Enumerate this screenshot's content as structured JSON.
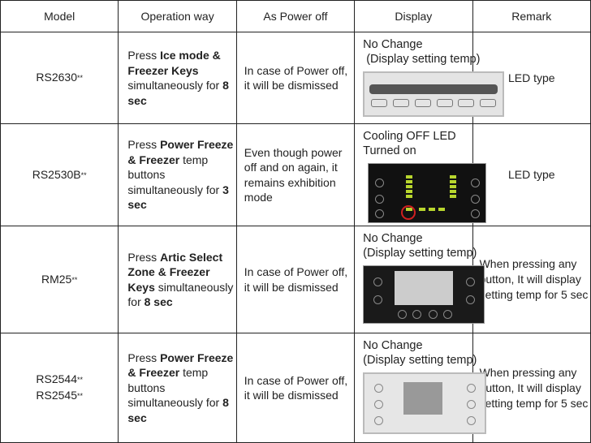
{
  "headers": [
    "Model",
    "Operation way",
    "As Power off",
    "Display",
    "Remark"
  ],
  "rows": [
    {
      "models": [
        "RS2630"
      ],
      "stars": "**",
      "operation": [
        {
          "text": "Press ",
          "bold": false
        },
        {
          "text": "Ice mode & Freezer Keys",
          "bold": true
        },
        {
          "text": " simultaneously for ",
          "bold": false
        },
        {
          "text": "8 sec",
          "bold": true
        }
      ],
      "power_off": "In case of Power off, it will be dismissed",
      "display_line1": "No Change",
      "display_line2": " (Display setting temp)",
      "display_panel": "light-led-panel",
      "remark": "LED type"
    },
    {
      "models": [
        "RS2530B"
      ],
      "stars": "**",
      "operation": [
        {
          "text": "Press ",
          "bold": false
        },
        {
          "text": "Power Freeze & Freezer",
          "bold": true
        },
        {
          "text": " temp buttons simultaneously for ",
          "bold": false
        },
        {
          "text": "3 sec",
          "bold": true
        }
      ],
      "power_off": "Even though power off and on again, it remains exhibition mode",
      "display_line1": "Cooling OFF LED",
      "display_line2": "Turned on",
      "display_panel": "dark-led-panel",
      "remark": "LED type"
    },
    {
      "models": [
        "RM25"
      ],
      "stars": "**",
      "operation": [
        {
          "text": "Press ",
          "bold": false
        },
        {
          "text": "Artic Select Zone & Freezer Keys",
          "bold": true
        },
        {
          "text": " simultaneously for ",
          "bold": false
        },
        {
          "text": "8 sec",
          "bold": true
        }
      ],
      "power_off": "In case of Power off, it will be dismissed",
      "display_line1": "No Change",
      "display_line2": "(Display setting temp)",
      "display_panel": "dark-lcd-panel",
      "remark": "When pressing any button, It will display setting temp for 5 sec"
    },
    {
      "models": [
        "RS2544",
        "RS2545"
      ],
      "stars": "**",
      "operation": [
        {
          "text": "Press ",
          "bold": false
        },
        {
          "text": "Power Freeze & Freezer",
          "bold": true
        },
        {
          "text": " temp buttons simultaneously for ",
          "bold": false
        },
        {
          "text": "8 sec",
          "bold": true
        }
      ],
      "power_off": "In case of Power off, it will be dismissed",
      "display_line1": "No Change",
      "display_line2": "(Display setting temp)",
      "display_panel": "light-lcd-panel",
      "remark": "When pressing any button, It will display setting temp for 5 sec"
    }
  ]
}
